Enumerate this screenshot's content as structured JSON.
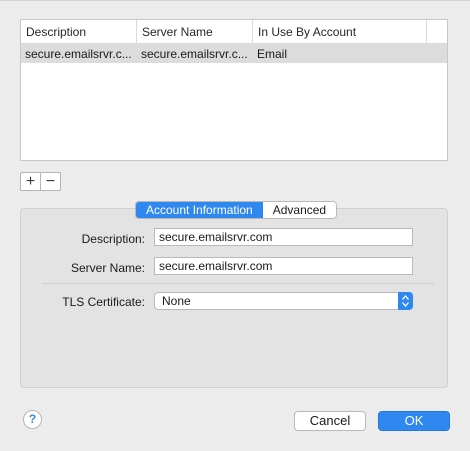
{
  "table": {
    "columns": [
      "Description",
      "Server Name",
      "In Use By Account"
    ],
    "rows": [
      {
        "description": "secure.emailsrvr.c...",
        "server_name": "secure.emailsrvr.c...",
        "in_use_by": "Email"
      }
    ]
  },
  "list_buttons": {
    "add": "+",
    "remove": "−"
  },
  "tabs": {
    "account_information": "Account Information",
    "advanced": "Advanced",
    "selected": "Account Information"
  },
  "form": {
    "description_label": "Description:",
    "description_value": "secure.emailsrvr.com",
    "server_name_label": "Server Name:",
    "server_name_value": "secure.emailsrvr.com",
    "tls_label": "TLS Certificate:",
    "tls_value": "None"
  },
  "footer": {
    "help": "?",
    "cancel": "Cancel",
    "ok": "OK"
  },
  "colors": {
    "accent": "#2f88f0",
    "selected_row": "#dcdcdc",
    "window_bg": "#ececec"
  },
  "icons": {
    "help": "help-icon",
    "add": "plus-icon",
    "remove": "minus-icon",
    "select_arrows": "chevron-updown-icon"
  }
}
